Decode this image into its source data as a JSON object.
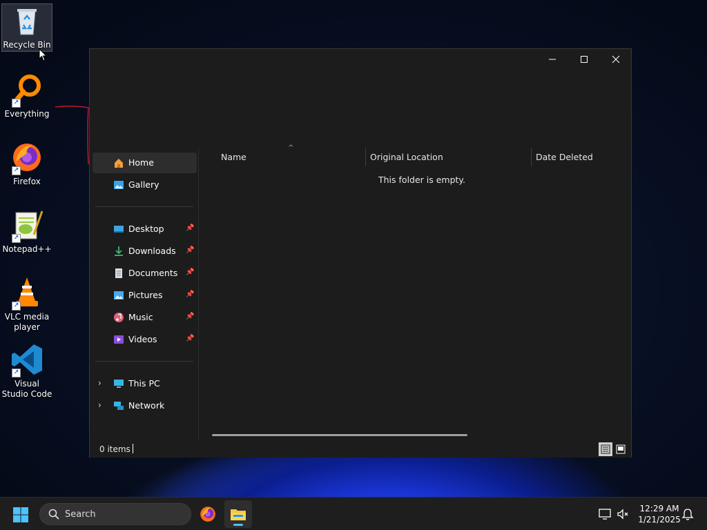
{
  "desktop": {
    "icons": [
      {
        "label": "Recycle Bin",
        "icon": "recycle-bin-icon"
      },
      {
        "label": "Everything",
        "icon": "everything-search-icon"
      },
      {
        "label": "Firefox",
        "icon": "firefox-icon"
      },
      {
        "label": "Notepad++",
        "icon": "notepad-plus-plus-icon"
      },
      {
        "label": "VLC media player",
        "icon": "vlc-icon"
      },
      {
        "label": "Visual Studio Code",
        "icon": "vscode-icon"
      }
    ]
  },
  "explorer": {
    "nav": {
      "home": "Home",
      "gallery": "Gallery",
      "quick_access": [
        {
          "label": "Desktop",
          "icon": "desktop-folder-icon"
        },
        {
          "label": "Downloads",
          "icon": "downloads-icon"
        },
        {
          "label": "Documents",
          "icon": "documents-icon"
        },
        {
          "label": "Pictures",
          "icon": "pictures-icon"
        },
        {
          "label": "Music",
          "icon": "music-icon"
        },
        {
          "label": "Videos",
          "icon": "videos-icon"
        }
      ],
      "this_pc": "This PC",
      "network": "Network"
    },
    "columns": [
      "Name",
      "Original Location",
      "Date Deleted"
    ],
    "empty_message": "This folder is empty.",
    "status": "0 items"
  },
  "taskbar": {
    "search_placeholder": "Search",
    "time": "12:29 AM",
    "date": "1/21/2025"
  },
  "colors": {
    "window_bg": "#1c1c1c",
    "accent": "#4cc2ff",
    "taskbar_bg": "#1e1e1e"
  }
}
